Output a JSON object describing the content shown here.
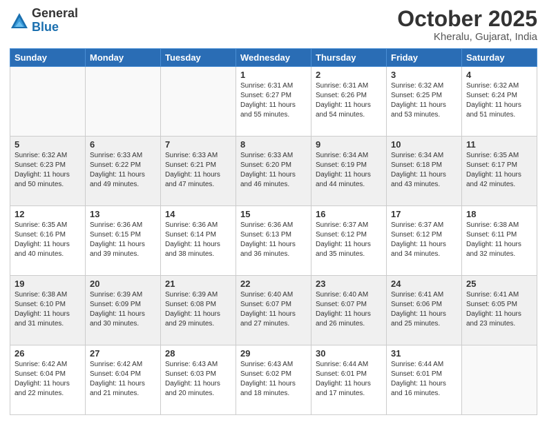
{
  "logo": {
    "general": "General",
    "blue": "Blue"
  },
  "header": {
    "month": "October 2025",
    "location": "Kheralu, Gujarat, India"
  },
  "weekdays": [
    "Sunday",
    "Monday",
    "Tuesday",
    "Wednesday",
    "Thursday",
    "Friday",
    "Saturday"
  ],
  "weeks": [
    [
      {
        "day": "",
        "info": ""
      },
      {
        "day": "",
        "info": ""
      },
      {
        "day": "",
        "info": ""
      },
      {
        "day": "1",
        "info": "Sunrise: 6:31 AM\nSunset: 6:27 PM\nDaylight: 11 hours\nand 55 minutes."
      },
      {
        "day": "2",
        "info": "Sunrise: 6:31 AM\nSunset: 6:26 PM\nDaylight: 11 hours\nand 54 minutes."
      },
      {
        "day": "3",
        "info": "Sunrise: 6:32 AM\nSunset: 6:25 PM\nDaylight: 11 hours\nand 53 minutes."
      },
      {
        "day": "4",
        "info": "Sunrise: 6:32 AM\nSunset: 6:24 PM\nDaylight: 11 hours\nand 51 minutes."
      }
    ],
    [
      {
        "day": "5",
        "info": "Sunrise: 6:32 AM\nSunset: 6:23 PM\nDaylight: 11 hours\nand 50 minutes."
      },
      {
        "day": "6",
        "info": "Sunrise: 6:33 AM\nSunset: 6:22 PM\nDaylight: 11 hours\nand 49 minutes."
      },
      {
        "day": "7",
        "info": "Sunrise: 6:33 AM\nSunset: 6:21 PM\nDaylight: 11 hours\nand 47 minutes."
      },
      {
        "day": "8",
        "info": "Sunrise: 6:33 AM\nSunset: 6:20 PM\nDaylight: 11 hours\nand 46 minutes."
      },
      {
        "day": "9",
        "info": "Sunrise: 6:34 AM\nSunset: 6:19 PM\nDaylight: 11 hours\nand 44 minutes."
      },
      {
        "day": "10",
        "info": "Sunrise: 6:34 AM\nSunset: 6:18 PM\nDaylight: 11 hours\nand 43 minutes."
      },
      {
        "day": "11",
        "info": "Sunrise: 6:35 AM\nSunset: 6:17 PM\nDaylight: 11 hours\nand 42 minutes."
      }
    ],
    [
      {
        "day": "12",
        "info": "Sunrise: 6:35 AM\nSunset: 6:16 PM\nDaylight: 11 hours\nand 40 minutes."
      },
      {
        "day": "13",
        "info": "Sunrise: 6:36 AM\nSunset: 6:15 PM\nDaylight: 11 hours\nand 39 minutes."
      },
      {
        "day": "14",
        "info": "Sunrise: 6:36 AM\nSunset: 6:14 PM\nDaylight: 11 hours\nand 38 minutes."
      },
      {
        "day": "15",
        "info": "Sunrise: 6:36 AM\nSunset: 6:13 PM\nDaylight: 11 hours\nand 36 minutes."
      },
      {
        "day": "16",
        "info": "Sunrise: 6:37 AM\nSunset: 6:12 PM\nDaylight: 11 hours\nand 35 minutes."
      },
      {
        "day": "17",
        "info": "Sunrise: 6:37 AM\nSunset: 6:12 PM\nDaylight: 11 hours\nand 34 minutes."
      },
      {
        "day": "18",
        "info": "Sunrise: 6:38 AM\nSunset: 6:11 PM\nDaylight: 11 hours\nand 32 minutes."
      }
    ],
    [
      {
        "day": "19",
        "info": "Sunrise: 6:38 AM\nSunset: 6:10 PM\nDaylight: 11 hours\nand 31 minutes."
      },
      {
        "day": "20",
        "info": "Sunrise: 6:39 AM\nSunset: 6:09 PM\nDaylight: 11 hours\nand 30 minutes."
      },
      {
        "day": "21",
        "info": "Sunrise: 6:39 AM\nSunset: 6:08 PM\nDaylight: 11 hours\nand 29 minutes."
      },
      {
        "day": "22",
        "info": "Sunrise: 6:40 AM\nSunset: 6:07 PM\nDaylight: 11 hours\nand 27 minutes."
      },
      {
        "day": "23",
        "info": "Sunrise: 6:40 AM\nSunset: 6:07 PM\nDaylight: 11 hours\nand 26 minutes."
      },
      {
        "day": "24",
        "info": "Sunrise: 6:41 AM\nSunset: 6:06 PM\nDaylight: 11 hours\nand 25 minutes."
      },
      {
        "day": "25",
        "info": "Sunrise: 6:41 AM\nSunset: 6:05 PM\nDaylight: 11 hours\nand 23 minutes."
      }
    ],
    [
      {
        "day": "26",
        "info": "Sunrise: 6:42 AM\nSunset: 6:04 PM\nDaylight: 11 hours\nand 22 minutes."
      },
      {
        "day": "27",
        "info": "Sunrise: 6:42 AM\nSunset: 6:04 PM\nDaylight: 11 hours\nand 21 minutes."
      },
      {
        "day": "28",
        "info": "Sunrise: 6:43 AM\nSunset: 6:03 PM\nDaylight: 11 hours\nand 20 minutes."
      },
      {
        "day": "29",
        "info": "Sunrise: 6:43 AM\nSunset: 6:02 PM\nDaylight: 11 hours\nand 18 minutes."
      },
      {
        "day": "30",
        "info": "Sunrise: 6:44 AM\nSunset: 6:01 PM\nDaylight: 11 hours\nand 17 minutes."
      },
      {
        "day": "31",
        "info": "Sunrise: 6:44 AM\nSunset: 6:01 PM\nDaylight: 11 hours\nand 16 minutes."
      },
      {
        "day": "",
        "info": ""
      }
    ]
  ]
}
